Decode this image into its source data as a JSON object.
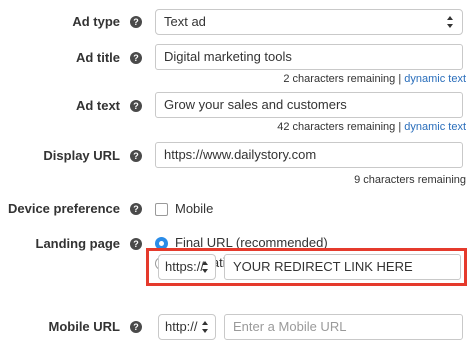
{
  "ad_type": {
    "label": "Ad type",
    "value": "Text ad"
  },
  "ad_title": {
    "label": "Ad title",
    "value": "Digital marketing tools",
    "remaining": "2 characters remaining",
    "link": "dynamic text"
  },
  "ad_text": {
    "label": "Ad text",
    "value": "Grow your sales and customers",
    "remaining": "42 characters remaining",
    "link": "dynamic text"
  },
  "display_url": {
    "label": "Display URL",
    "value": "https://www.dailystory.com",
    "remaining": "9 characters remaining"
  },
  "device_preference": {
    "label": "Device preference",
    "option": "Mobile",
    "checked": false
  },
  "landing_page": {
    "label": "Landing page",
    "options": [
      {
        "label": "Final URL (recommended)",
        "selected": true
      },
      {
        "label": "Destination URL",
        "selected": false
      }
    ],
    "protocol": "https://",
    "url_value": "YOUR REDIRECT LINK HERE"
  },
  "mobile_url": {
    "label": "Mobile URL",
    "protocol": "http://",
    "placeholder": "Enter a Mobile URL"
  },
  "help_glyph": "?",
  "separator": "|",
  "colors": {
    "highlight": "#e53a2c",
    "link": "#2a6ebb",
    "radio_selected": "#2a8ce8"
  }
}
